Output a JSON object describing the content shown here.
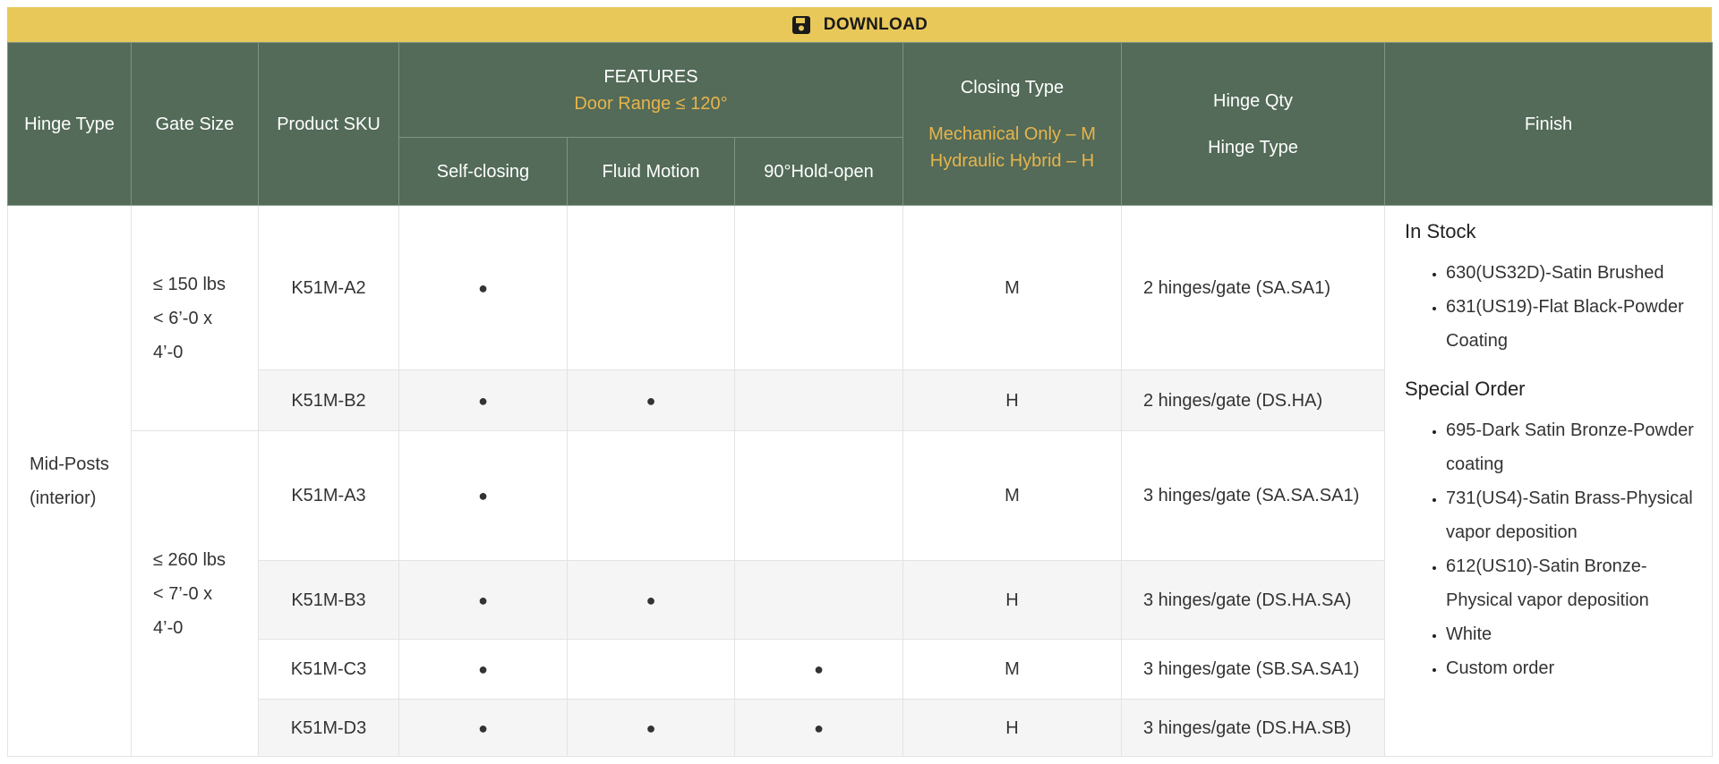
{
  "download": {
    "label": "DOWNLOAD",
    "icon": "floppy-disk-icon"
  },
  "colors": {
    "header_bg": "#536b58",
    "accent": "#e8b44c",
    "download_bg": "#e9c85a"
  },
  "header": {
    "hinge_type": "Hinge Type",
    "gate_size": "Gate Size",
    "product_sku": "Product SKU",
    "features": "FEATURES",
    "features_sub": "Door Range ≤ 120°",
    "self_closing": "Self-closing",
    "fluid_motion": "Fluid Motion",
    "hold_open": "90°Hold-open",
    "closing_type": "Closing Type",
    "closing_m": "Mechanical Only – M",
    "closing_h": "Hydraulic Hybrid – H",
    "hinge_qty": "Hinge Qty",
    "hinge_type2": "Hinge Type",
    "finish": "Finish"
  },
  "hinge_type_value_1": "Mid-Posts",
  "hinge_type_value_2": "(interior)",
  "gate_groups": [
    {
      "line1": "≤ 150 lbs",
      "line2": "< 6’-0 x",
      "line3": "4’-0"
    },
    {
      "line1": "≤ 260 lbs",
      "line2": "< 7’-0 x",
      "line3": "4’-0"
    }
  ],
  "rows": [
    {
      "sku": "K51M-A2",
      "self_closing": "●",
      "fluid_motion": "",
      "hold_open": "",
      "closing": "M",
      "qty": "2 hinges/gate (SA.SA1)"
    },
    {
      "sku": "K51M-B2",
      "self_closing": "●",
      "fluid_motion": "●",
      "hold_open": "",
      "closing": "H",
      "qty": "2 hinges/gate (DS.HA)"
    },
    {
      "sku": "K51M-A3",
      "self_closing": "●",
      "fluid_motion": "",
      "hold_open": "",
      "closing": "M",
      "qty": "3 hinges/gate (SA.SA.SA1)"
    },
    {
      "sku": "K51M-B3",
      "self_closing": "●",
      "fluid_motion": "●",
      "hold_open": "",
      "closing": "H",
      "qty": "3 hinges/gate (DS.HA.SA)"
    },
    {
      "sku": "K51M-C3",
      "self_closing": "●",
      "fluid_motion": "",
      "hold_open": "●",
      "closing": "M",
      "qty": "3 hinges/gate (SB.SA.SA1)"
    },
    {
      "sku": "K51M-D3",
      "self_closing": "●",
      "fluid_motion": "●",
      "hold_open": "●",
      "closing": "H",
      "qty": "3 hinges/gate (DS.HA.SB)"
    }
  ],
  "finish": {
    "in_stock_title": "In Stock",
    "in_stock": [
      "630(US32D)-Satin Brushed",
      "631(US19)-Flat Black-Powder Coating"
    ],
    "special_title": "Special Order",
    "special": [
      "695-Dark Satin Bronze-Powder coating",
      "731(US4)-Satin Brass-Physical vapor deposition",
      "612(US10)-Satin Bronze-Physical vapor deposition",
      "White",
      "Custom order"
    ]
  }
}
